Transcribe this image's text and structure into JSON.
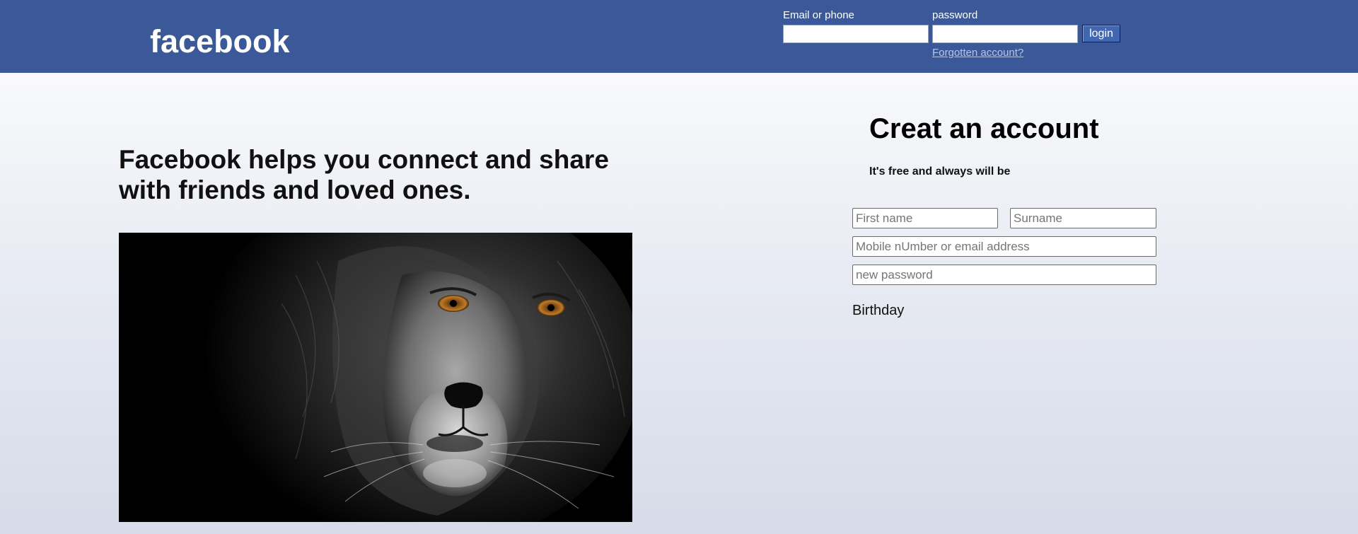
{
  "header": {
    "logo_text": "facebook",
    "email_label": "Email or phone",
    "password_label": "password",
    "login_button": "login",
    "forgot_link": "Forgotten account?",
    "background_color": "#3b5998"
  },
  "hero": {
    "tagline": "Facebook helps you connect and share with friends and loved ones."
  },
  "signup": {
    "title": "Creat an account",
    "subtitle": "It's free and always will be",
    "first_name_placeholder": "First name",
    "surname_placeholder": "Surname",
    "contact_placeholder": "Mobile nUmber or email address",
    "password_placeholder": "new password",
    "birthday_label": "Birthday"
  },
  "colors": {
    "brand_blue": "#3b5998",
    "button_blue": "#4267b2",
    "link_color": "#b5c6ea"
  }
}
